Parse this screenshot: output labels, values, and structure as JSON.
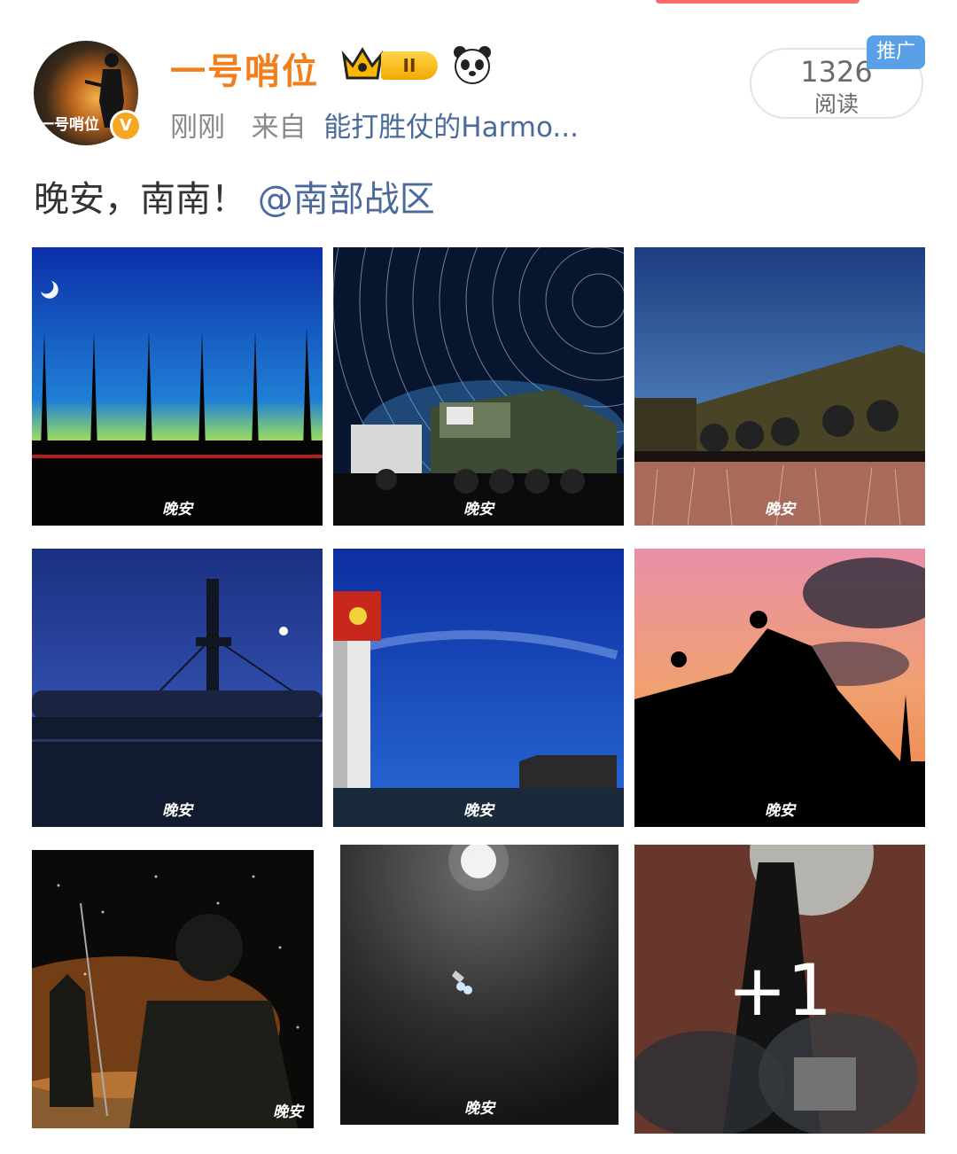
{
  "post": {
    "author": {
      "name": "一号哨位",
      "avatar_text": "一号哨位",
      "verified_mark": "V",
      "rank_badge": "II"
    },
    "meta": {
      "time": "刚刚",
      "source_prefix": "来自",
      "source": "能打胜仗的Harmo..."
    },
    "reads": {
      "count": "1326",
      "label": "阅读"
    },
    "promo_tag": "推广",
    "text": "晚安，南南！",
    "mention": "@南部战区",
    "images": [
      {
        "caption": "晚安"
      },
      {
        "caption": "晚安"
      },
      {
        "caption": "晚安"
      },
      {
        "caption": "晚安"
      },
      {
        "caption": "晚安"
      },
      {
        "caption": "晚安"
      },
      {
        "caption": "晚安"
      },
      {
        "caption": "晚安"
      },
      {
        "caption": "",
        "overlay": "+1"
      }
    ]
  },
  "icons": [
    "crown-icon",
    "panda-icon",
    "verified-icon"
  ]
}
